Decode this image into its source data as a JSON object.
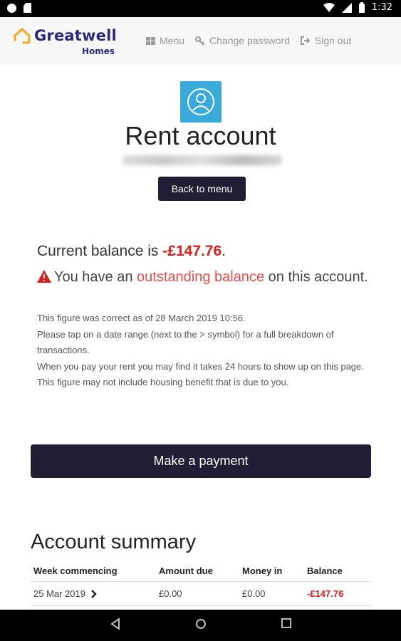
{
  "status_bar": {
    "time": "1:32"
  },
  "header": {
    "logo_main": "Greatwell",
    "logo_sub": "Homes",
    "nav": [
      {
        "label": "Menu",
        "icon": "grid-icon"
      },
      {
        "label": "Change password",
        "icon": "key-icon"
      },
      {
        "label": "Sign out",
        "icon": "sign-out-icon"
      }
    ]
  },
  "page": {
    "title": "Rent account",
    "back_button": "Back to menu"
  },
  "balance": {
    "prefix": "Current balance is ",
    "amount": "-£147.76",
    "suffix": ".",
    "warning_before": "You have an ",
    "warning_link": "outstanding balance",
    "warning_after": " on this account.",
    "info_lines": [
      "This figure was correct as of 28 March 2019 10:56.",
      "Please tap on a date range (next to the > symbol) for a full breakdown of transactions.",
      "When you pay your rent you may find it takes 24 hours to show up on this page. This figure may not include housing benefit that is due to you."
    ]
  },
  "payment_button": "Make a payment",
  "summary": {
    "title": "Account summary",
    "columns": [
      "Week commencing",
      "Amount due",
      "Money in",
      "Balance"
    ],
    "rows": [
      {
        "week": "25 Mar 2019",
        "amount_due": "£0.00",
        "money_in": "£0.00",
        "balance": "-£147.76"
      }
    ]
  },
  "colors": {
    "brand_navy": "#201d34",
    "accent_orange": "#f5a623",
    "negative_red": "#e31b1b",
    "avatar_blue": "#3aaadb"
  }
}
